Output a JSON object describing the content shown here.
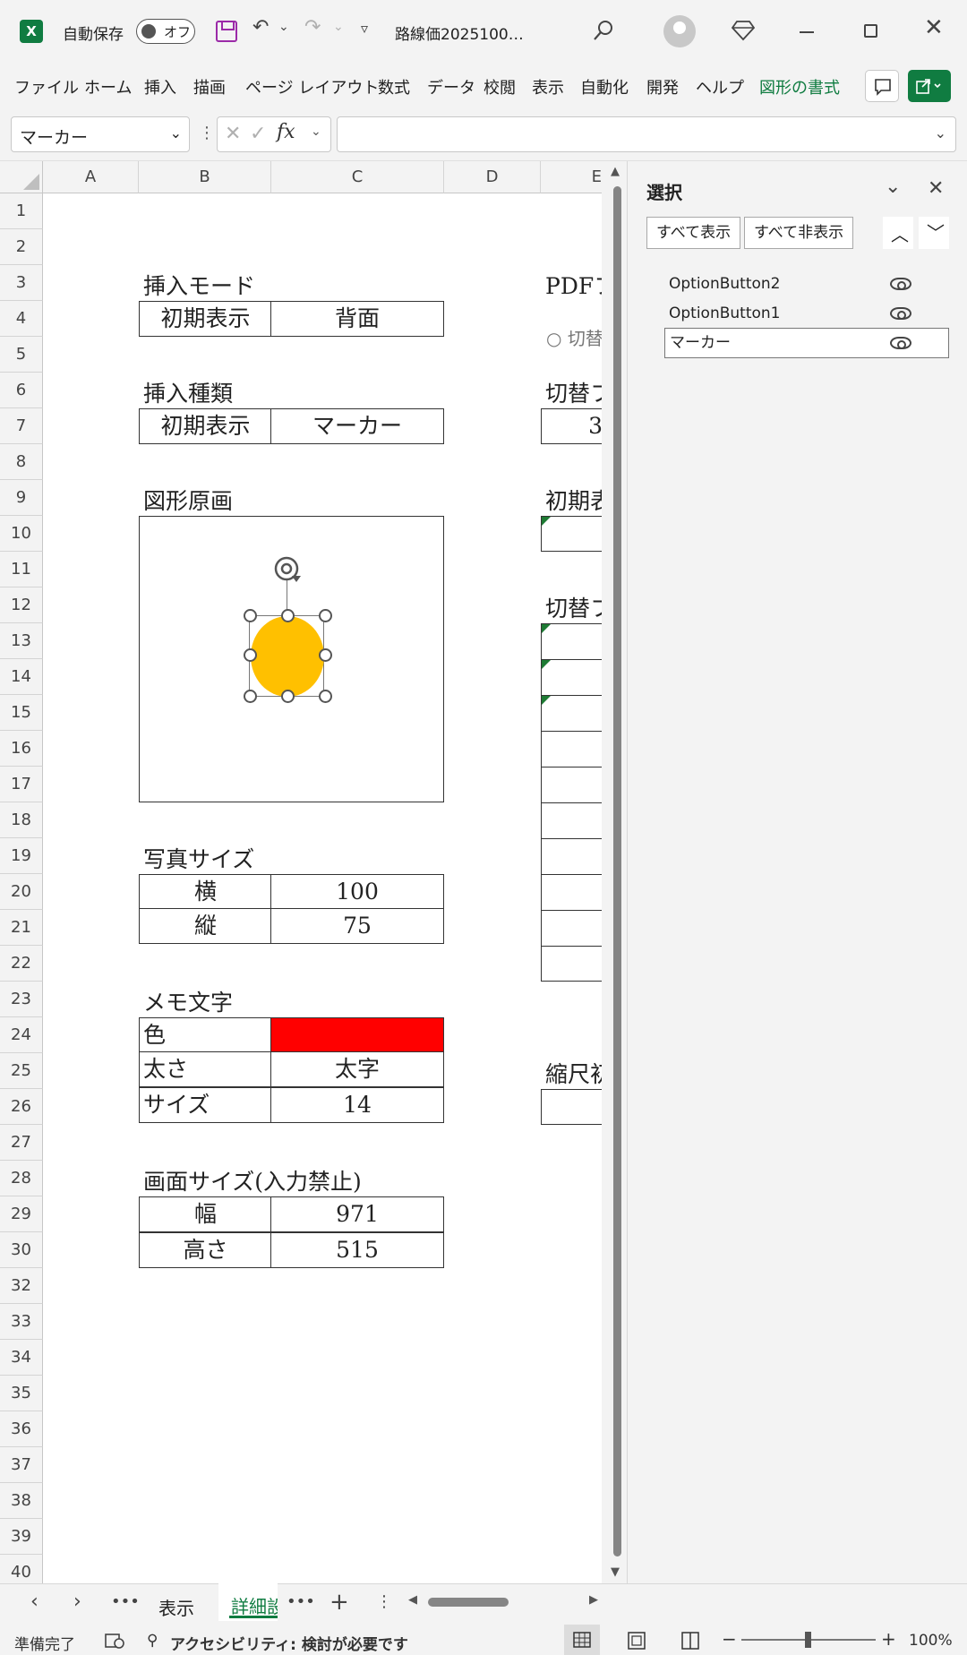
{
  "titlebar": {
    "autosave_label": "自動保存",
    "autosave_state": "オフ",
    "filename": "路線価2025100…"
  },
  "ribbon": {
    "tabs": [
      "ファイル",
      "ホーム",
      "挿入",
      "描画",
      "ページ レイアウト",
      "数式",
      "データ",
      "校閲",
      "表示",
      "自動化",
      "開発",
      "ヘルプ",
      "図形の書式"
    ],
    "active_tab": "図形の書式"
  },
  "formula_bar": {
    "name_box": "マーカー",
    "fx_label": "fx",
    "formula": ""
  },
  "grid": {
    "columns": [
      "A",
      "B",
      "C",
      "D",
      "E"
    ],
    "rows": [
      "1",
      "2",
      "3",
      "4",
      "5",
      "6",
      "7",
      "8",
      "9",
      "10",
      "11",
      "12",
      "13",
      "14",
      "15",
      "16",
      "17",
      "18",
      "19",
      "20",
      "21",
      "22",
      "23",
      "24",
      "25",
      "26",
      "27",
      "28",
      "29",
      "30",
      "32",
      "33",
      "34",
      "35",
      "36",
      "37",
      "38",
      "39",
      "40"
    ],
    "insert_mode": {
      "title": "挿入モード",
      "label": "初期表示",
      "value": "背面"
    },
    "insert_type": {
      "title": "挿入種類",
      "label": "初期表示",
      "value": "マーカー"
    },
    "shape_original": {
      "title": "図形原画"
    },
    "photo_size": {
      "title": "写真サイズ",
      "rows": [
        {
          "label": "横",
          "value": "100"
        },
        {
          "label": "縦",
          "value": "75"
        }
      ]
    },
    "memo_text": {
      "title": "メモ文字",
      "rows": [
        {
          "label": "色",
          "value": ""
        },
        {
          "label": "太さ",
          "value": "太字"
        },
        {
          "label": "サイズ",
          "value": "14"
        }
      ],
      "color_swatch": "#ff0000"
    },
    "screen_size": {
      "title": "画面サイズ(入力禁止)",
      "rows": [
        {
          "label": "幅",
          "value": "971"
        },
        {
          "label": "高さ",
          "value": "515"
        }
      ]
    },
    "right_col": {
      "pdf_title": "PDFフ",
      "switch_radio": "切替",
      "switch_title1": "切替フ",
      "switch_value": "3",
      "initial_title": "初期表",
      "switch_title2": "切替フ",
      "scale_title": "縮尺初"
    },
    "marker_color": "#ffc000"
  },
  "selection_pane": {
    "title": "選択",
    "show_all": "すべて表示",
    "hide_all": "すべて非表示",
    "items": [
      "OptionButton2",
      "OptionButton1",
      "マーカー"
    ],
    "selected": "マーカー"
  },
  "sheet_tabs": {
    "tabs": [
      "表示",
      "詳細設"
    ],
    "active": "詳細設"
  },
  "status": {
    "ready": "準備完了",
    "accessibility": "アクセシビリティ: 検討が必要です",
    "zoom": "100%"
  }
}
